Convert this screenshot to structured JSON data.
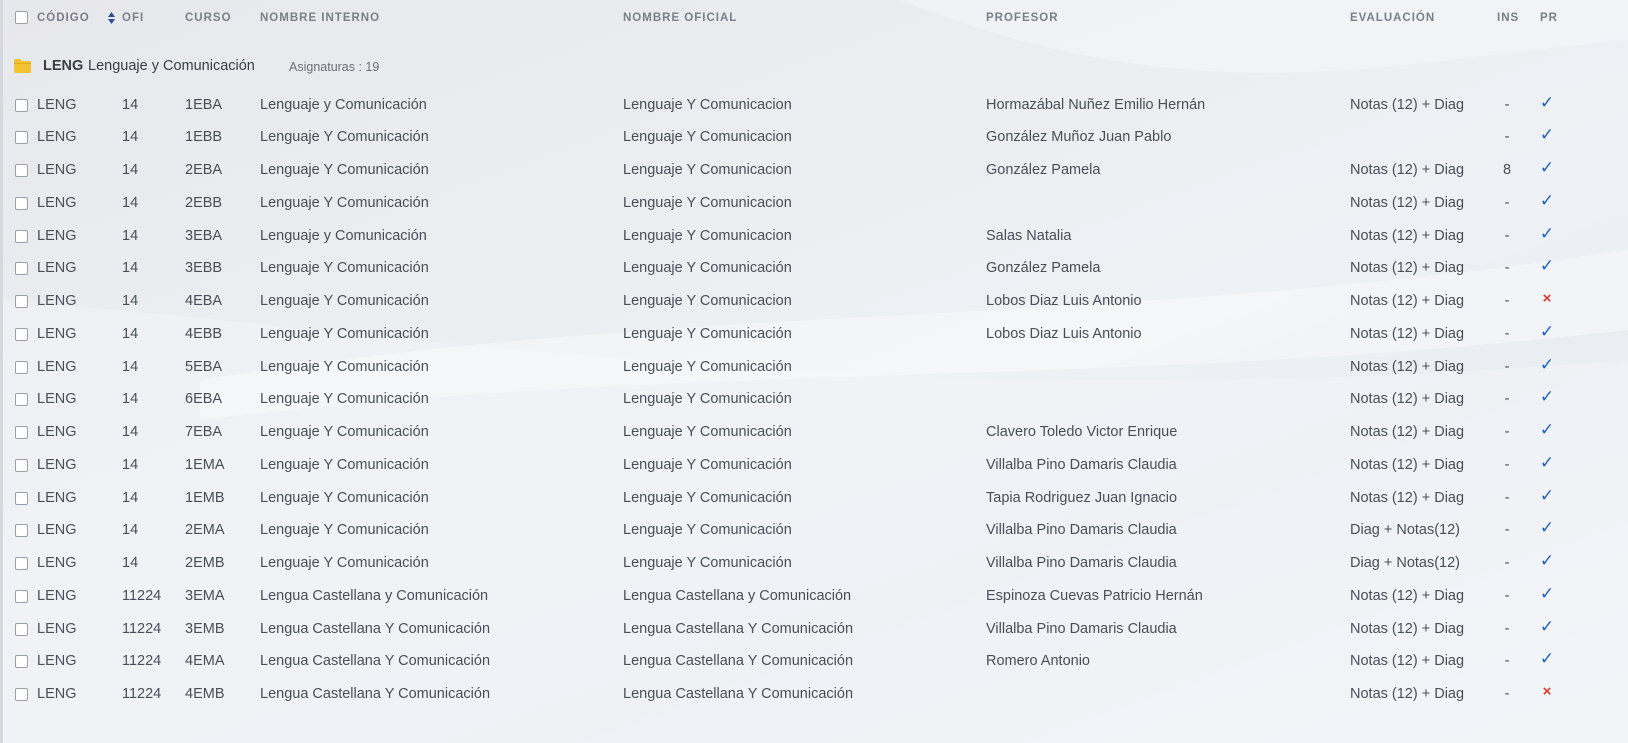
{
  "header": {
    "codigo": "CÓDIGO",
    "ofi": "OFI",
    "curso": "CURSO",
    "nombre_interno": "NOMBRE INTERNO",
    "nombre_oficial": "NOMBRE OFICIAL",
    "profesor": "PROFESOR",
    "evaluacion": "EVALUACIÓN",
    "ins": "INS",
    "pr": "PR"
  },
  "group": {
    "code": "LENG",
    "name": "Lenguaje y Comunicación",
    "count": "Asignaturas : 19",
    "icon": "folder-icon"
  },
  "colors": {
    "check": "#1f5fbf",
    "cross": "#d93a2b",
    "folder": "#f2c230"
  },
  "rows": [
    {
      "code": "LENG",
      "ofi": "14",
      "curso": "1EBA",
      "interno": "Lenguaje y Comunicación",
      "oficial": "Lenguaje Y Comunicacion",
      "profesor": "Hormazábal Nuñez Emilio Hernán",
      "evaluacion": "Notas (12) + Diag",
      "ins": "-",
      "pr": "check"
    },
    {
      "code": "LENG",
      "ofi": "14",
      "curso": "1EBB",
      "interno": "Lenguaje Y Comunicación",
      "oficial": "Lenguaje Y Comunicacion",
      "profesor": "González Muñoz Juan Pablo",
      "evaluacion": "",
      "ins": "-",
      "pr": "check"
    },
    {
      "code": "LENG",
      "ofi": "14",
      "curso": "2EBA",
      "interno": "Lenguaje Y Comunicación",
      "oficial": "Lenguaje Y Comunicacion",
      "profesor": "González Pamela",
      "evaluacion": "Notas (12) + Diag",
      "ins": "8",
      "pr": "check"
    },
    {
      "code": "LENG",
      "ofi": "14",
      "curso": "2EBB",
      "interno": "Lenguaje Y Comunicación",
      "oficial": "Lenguaje Y Comunicacion",
      "profesor": "",
      "evaluacion": "Notas (12) + Diag",
      "ins": "-",
      "pr": "check"
    },
    {
      "code": "LENG",
      "ofi": "14",
      "curso": "3EBA",
      "interno": "Lenguaje y Comunicación",
      "oficial": "Lenguaje Y Comunicacion",
      "profesor": "Salas Natalia",
      "evaluacion": "Notas (12) + Diag",
      "ins": "-",
      "pr": "check"
    },
    {
      "code": "LENG",
      "ofi": "14",
      "curso": "3EBB",
      "interno": "Lenguaje Y Comunicación",
      "oficial": "Lenguaje Y Comunicación",
      "profesor": "González Pamela",
      "evaluacion": "Notas (12) + Diag",
      "ins": "-",
      "pr": "check"
    },
    {
      "code": "LENG",
      "ofi": "14",
      "curso": "4EBA",
      "interno": "Lenguaje Y Comunicación",
      "oficial": "Lenguaje Y Comunicacion",
      "profesor": "Lobos Diaz Luis Antonio",
      "evaluacion": "Notas (12) + Diag",
      "ins": "-",
      "pr": "cross"
    },
    {
      "code": "LENG",
      "ofi": "14",
      "curso": "4EBB",
      "interno": "Lenguaje Y Comunicación",
      "oficial": "Lenguaje Y Comunicación",
      "profesor": "Lobos Diaz Luis Antonio",
      "evaluacion": "Notas (12) + Diag",
      "ins": "-",
      "pr": "check"
    },
    {
      "code": "LENG",
      "ofi": "14",
      "curso": "5EBA",
      "interno": "Lenguaje Y Comunicación",
      "oficial": "Lenguaje Y Comunicación",
      "profesor": "",
      "evaluacion": "Notas (12) + Diag",
      "ins": "-",
      "pr": "check"
    },
    {
      "code": "LENG",
      "ofi": "14",
      "curso": "6EBA",
      "interno": "Lenguaje Y Comunicación",
      "oficial": "Lenguaje Y Comunicación",
      "profesor": "",
      "evaluacion": "Notas (12) + Diag",
      "ins": "-",
      "pr": "check"
    },
    {
      "code": "LENG",
      "ofi": "14",
      "curso": "7EBA",
      "interno": "Lenguaje Y Comunicación",
      "oficial": "Lenguaje Y Comunicación",
      "profesor": "Clavero Toledo Victor Enrique",
      "evaluacion": "Notas (12) + Diag",
      "ins": "-",
      "pr": "check"
    },
    {
      "code": "LENG",
      "ofi": "14",
      "curso": "1EMA",
      "interno": "Lenguaje Y Comunicación",
      "oficial": "Lenguaje Y Comunicación",
      "profesor": "Villalba Pino Damaris Claudia",
      "evaluacion": "Notas (12) + Diag",
      "ins": "-",
      "pr": "check"
    },
    {
      "code": "LENG",
      "ofi": "14",
      "curso": "1EMB",
      "interno": "Lenguaje Y Comunicación",
      "oficial": "Lenguaje Y Comunicación",
      "profesor": "Tapia Rodriguez Juan  Ignacio",
      "evaluacion": "Notas (12) + Diag",
      "ins": "-",
      "pr": "check"
    },
    {
      "code": "LENG",
      "ofi": "14",
      "curso": "2EMA",
      "interno": "Lenguaje Y Comunicación",
      "oficial": "Lenguaje Y Comunicación",
      "profesor": "Villalba Pino Damaris Claudia",
      "evaluacion": "Diag + Notas(12)",
      "ins": "-",
      "pr": "check"
    },
    {
      "code": "LENG",
      "ofi": "14",
      "curso": "2EMB",
      "interno": "Lenguaje Y Comunicación",
      "oficial": "Lenguaje Y Comunicación",
      "profesor": "Villalba Pino Damaris Claudia",
      "evaluacion": "Diag + Notas(12)",
      "ins": "-",
      "pr": "check"
    },
    {
      "code": "LENG",
      "ofi": "11224",
      "curso": "3EMA",
      "interno": "Lengua Castellana y Comunicación",
      "oficial": "Lengua Castellana y Comunicación",
      "profesor": "Espinoza Cuevas Patricio Hernán",
      "evaluacion": "Notas (12) + Diag",
      "ins": "-",
      "pr": "check"
    },
    {
      "code": "LENG",
      "ofi": "11224",
      "curso": "3EMB",
      "interno": "Lengua Castellana Y Comunicación",
      "oficial": "Lengua Castellana Y Comunicación",
      "profesor": "Villalba Pino Damaris Claudia",
      "evaluacion": "Notas (12) + Diag",
      "ins": "-",
      "pr": "check"
    },
    {
      "code": "LENG",
      "ofi": "11224",
      "curso": "4EMA",
      "interno": "Lengua Castellana Y Comunicación",
      "oficial": "Lengua Castellana Y Comunicación",
      "profesor": "Romero  Antonio",
      "evaluacion": "Notas (12) + Diag",
      "ins": "-",
      "pr": "check"
    },
    {
      "code": "LENG",
      "ofi": "11224",
      "curso": "4EMB",
      "interno": "Lengua Castellana Y Comunicación",
      "oficial": "Lengua Castellana Y Comunicación",
      "profesor": "",
      "evaluacion": "Notas (12) + Diag",
      "ins": "-",
      "pr": "cross"
    }
  ]
}
